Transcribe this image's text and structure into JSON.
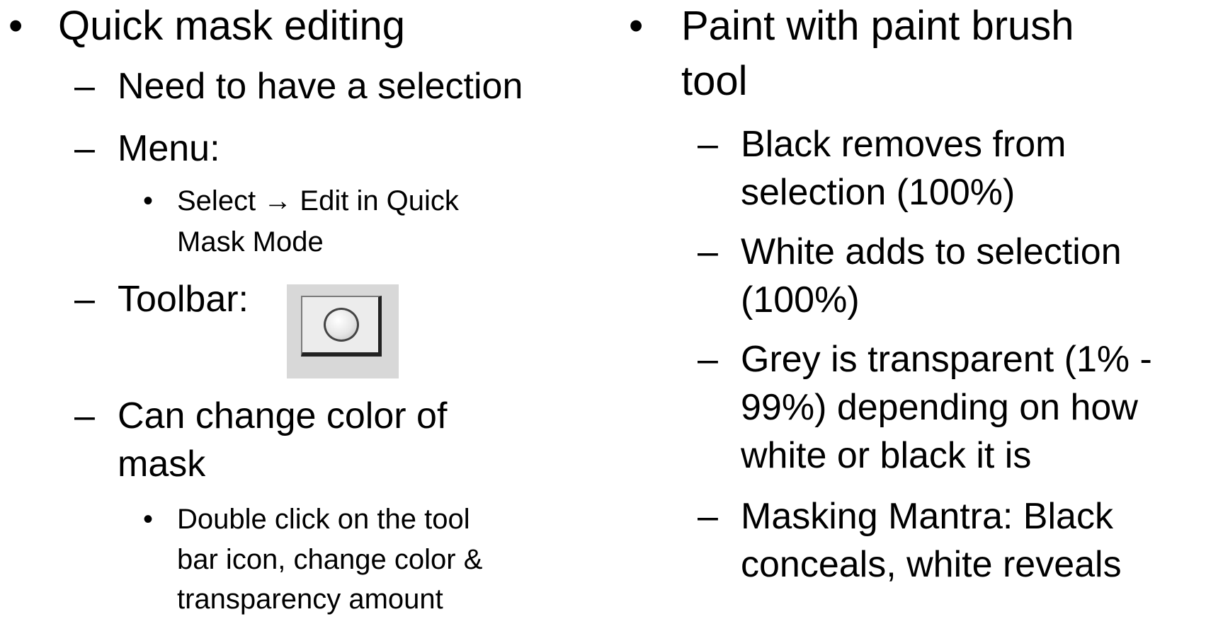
{
  "left": {
    "title": "Quick mask editing",
    "need_selection": "Need to have a selection",
    "menu_label": "Menu:",
    "menu_path_line1": "Select → Edit in Quick",
    "menu_path_line2": "Mask Mode",
    "toolbar_label": "Toolbar:",
    "toolbar_icon": "quick-mask-mode-icon",
    "change_color_line1": "Can change color of",
    "change_color_line2": "mask",
    "double_click_line1": "Double click on the tool",
    "double_click_line2": "bar icon, change color &",
    "double_click_line3": "transparency amount"
  },
  "right": {
    "title_line1": "Paint with paint brush",
    "title_line2": "tool",
    "black_line1": "Black removes from",
    "black_line2": "selection (100%)",
    "white_line1": "White adds to selection",
    "white_line2": "(100%)",
    "grey_line1": "Grey is transparent (1% -",
    "grey_line2": "99%) depending on how",
    "grey_line3": "white or black it is",
    "mantra_line1": "Masking Mantra: Black",
    "mantra_line2": "conceals, white reveals"
  },
  "bullets": {
    "level1": "•",
    "level2": "–",
    "level3": "•"
  }
}
